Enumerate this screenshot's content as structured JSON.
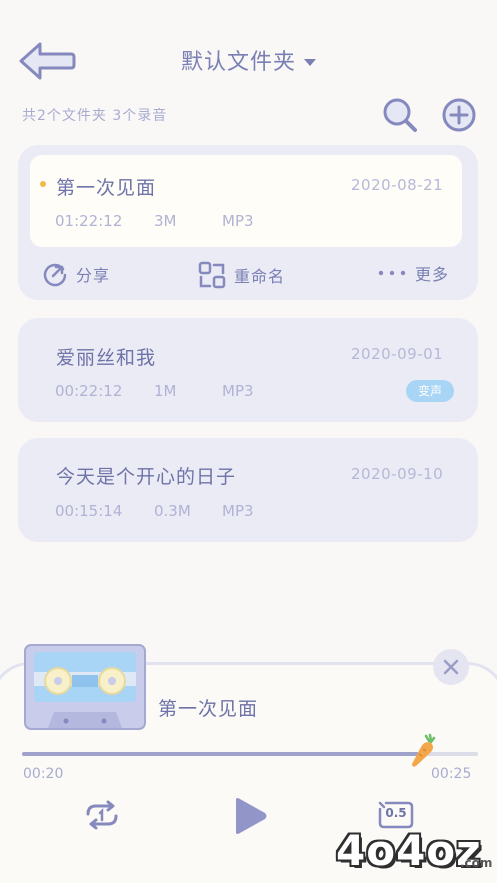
{
  "header": {
    "title": "默认文件夹",
    "summary": "共2个文件夹  3个录音",
    "icons": {
      "back": "back-arrow-icon",
      "search": "search-icon",
      "add": "plus-circle-icon",
      "dropdown": "caret-down-icon"
    }
  },
  "recordings": [
    {
      "name": "第一次见面",
      "date": "2020-08-21",
      "duration": "01:22:12",
      "size": "3M",
      "format": "MP3",
      "selected": true
    },
    {
      "name": "爱丽丝和我",
      "date": "2020-09-01",
      "duration": "00:22:12",
      "size": "1M",
      "format": "MP3",
      "badge": "变声"
    },
    {
      "name": "今天是个开心的日子",
      "date": "2020-09-10",
      "duration": "00:15:14",
      "size": "0.3M",
      "format": "MP3"
    }
  ],
  "actions": {
    "share": "分享",
    "rename": "重命名",
    "more": "更多"
  },
  "player": {
    "title": "第一次见面",
    "current_time": "00:20",
    "total_time": "00:25",
    "progress": 0.87,
    "speed": "0.5"
  },
  "watermark": {
    "text": "4o4oz",
    "suffix": ".com"
  },
  "colors": {
    "accent": "#6e73a8",
    "card": "#ebebf5",
    "badge": "#a8d4f5",
    "dot": "#f5b84e",
    "carrot": "#f3a64a"
  }
}
